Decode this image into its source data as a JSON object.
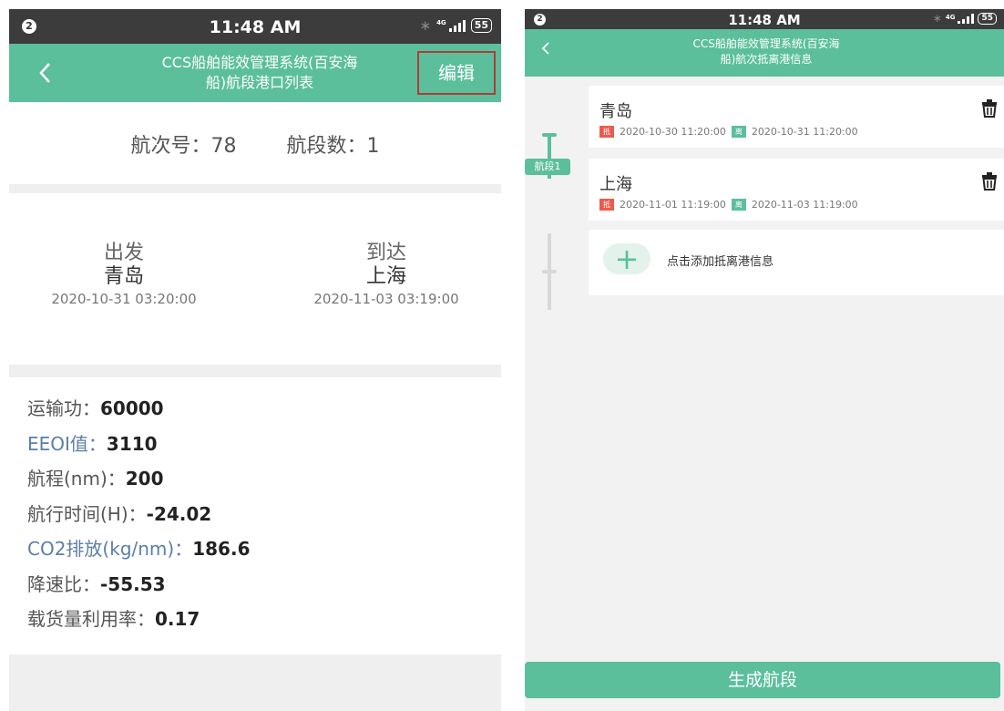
{
  "left": {
    "status": {
      "badge": "2",
      "time": "11:48 AM",
      "net": "4G",
      "battery": "55"
    },
    "nav": {
      "title_line1": "CCS船舶能效管理系统(百安海",
      "title_line2": "船)航段港口列表",
      "edit": "编辑"
    },
    "voyage": {
      "no_label": "航次号：",
      "no_value": "78",
      "seg_label": "航段数：",
      "seg_value": "1"
    },
    "route": {
      "depart_label": "出发",
      "depart_city": "青岛",
      "depart_time": "2020-10-31 03:20:00",
      "arrive_label": "到达",
      "arrive_city": "上海",
      "arrive_time": "2020-11-03 03:19:00"
    },
    "stats": [
      {
        "key": "运输功：",
        "value": "60000"
      },
      {
        "key": "EEOI值：",
        "value": "3110"
      },
      {
        "key": "航程(nm)：",
        "value": "200"
      },
      {
        "key": "航行时间(H)：",
        "value": "-24.02"
      },
      {
        "key": "CO2排放(kg/nm)：",
        "value": "186.6"
      },
      {
        "key": "降速比：",
        "value": "-55.53"
      },
      {
        "key": "载货量利用率：",
        "value": "0.17"
      }
    ]
  },
  "right": {
    "status": {
      "badge": "2",
      "time": "11:48 AM",
      "net": "4G",
      "battery": "55"
    },
    "nav": {
      "title_line1": "CCS船舶能效管理系统(百安海",
      "title_line2": "船)航次抵离港信息"
    },
    "segment_label": "航段1",
    "ports": [
      {
        "name": "青岛",
        "arr_tag": "抵",
        "arr_time": "2020-10-30 11:20:00",
        "dep_tag": "离",
        "dep_time": "2020-10-31 11:20:00"
      },
      {
        "name": "上海",
        "arr_tag": "抵",
        "arr_time": "2020-11-01 11:19:00",
        "dep_tag": "离",
        "dep_time": "2020-11-03 11:19:00"
      }
    ],
    "add_text": "点击添加抵离港信息",
    "generate_button": "生成航段"
  },
  "colors": {
    "accent": "#5bbf9c",
    "status_bar": "#3c3c3c",
    "arrive_tag": "#ef5a4f",
    "highlight_box": "#b33a3a"
  }
}
